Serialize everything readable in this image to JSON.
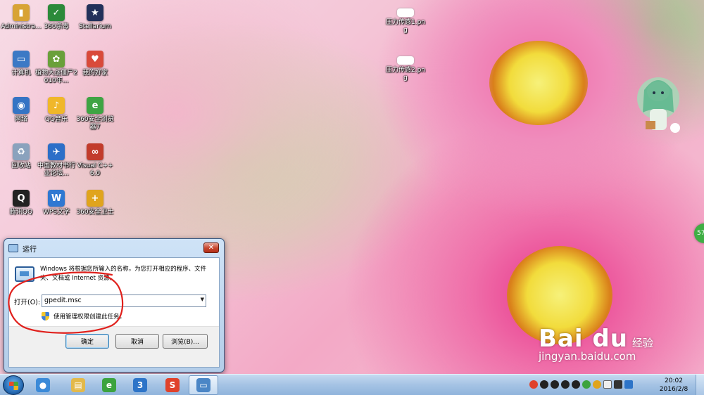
{
  "desktop_icons": [
    {
      "label": "Administra...",
      "color": "#d8a335",
      "glyph": "▮"
    },
    {
      "label": "360杀毒",
      "color": "#2c8a3a",
      "glyph": "✓"
    },
    {
      "label": "Stellarium",
      "color": "#22305a",
      "glyph": "★"
    },
    {
      "label": "计算机",
      "color": "#3c79c5",
      "glyph": "▭"
    },
    {
      "label": "植物大战僵尸2010年...",
      "color": "#6aa03a",
      "glyph": "✿"
    },
    {
      "label": "我的好家",
      "color": "#d94a3a",
      "glyph": "♥"
    },
    {
      "label": "网络",
      "color": "#3574c4",
      "glyph": "◉"
    },
    {
      "label": "QQ音乐",
      "color": "#f0b72a",
      "glyph": "♪"
    },
    {
      "label": "360安全浏览器7",
      "color": "#3ea443",
      "glyph": "e"
    },
    {
      "label": "回收站",
      "color": "#8aa2bd",
      "glyph": "♻"
    },
    {
      "label": "中国教材书行业论坛...",
      "color": "#2c6fc8",
      "glyph": "✈"
    },
    {
      "label": "Visual C++ 6.0",
      "color": "#c23b2b",
      "glyph": "∞"
    },
    {
      "label": "腾讯QQ",
      "color": "#222222",
      "glyph": "Q"
    },
    {
      "label": "WPS文字",
      "color": "#2e78d2",
      "glyph": "W"
    },
    {
      "label": "360安全卫士",
      "color": "#e0a41d",
      "glyph": "+"
    }
  ],
  "files": [
    {
      "label": "压力传感1.png"
    },
    {
      "label": "压力传感2.png"
    }
  ],
  "side_badge": "57",
  "run_dialog": {
    "title": "运行",
    "close": "✕",
    "description": "Windows 将根据您所输入的名称，为您打开相应的程序、文件夹、文档或 Internet 资源。",
    "open_label": "打开(O):",
    "command_value": "gpedit.msc",
    "admin_note": "使用管理权限创建此任务。",
    "ok": "确定",
    "cancel": "取消",
    "browse": "浏览(B)..."
  },
  "taskbar": {
    "apps": [
      {
        "name": "sogou-media",
        "color": "#3b8ad8",
        "glyph": "●"
      },
      {
        "name": "explorer",
        "color": "#e3b94a",
        "glyph": "▤"
      },
      {
        "name": "360-browser",
        "color": "#3ca33f",
        "glyph": "e"
      },
      {
        "name": "browser-2",
        "color": "#2d74c8",
        "glyph": "3"
      },
      {
        "name": "sogou-input",
        "color": "#e0422b",
        "glyph": "S"
      },
      {
        "name": "run",
        "color": "#4b86c6",
        "glyph": "▭"
      }
    ],
    "clock_time": "20:02",
    "clock_date": "2016/2/8"
  },
  "watermark": {
    "brand": "Bai du",
    "cn": "经验",
    "url": "jingyan.baidu.com"
  }
}
